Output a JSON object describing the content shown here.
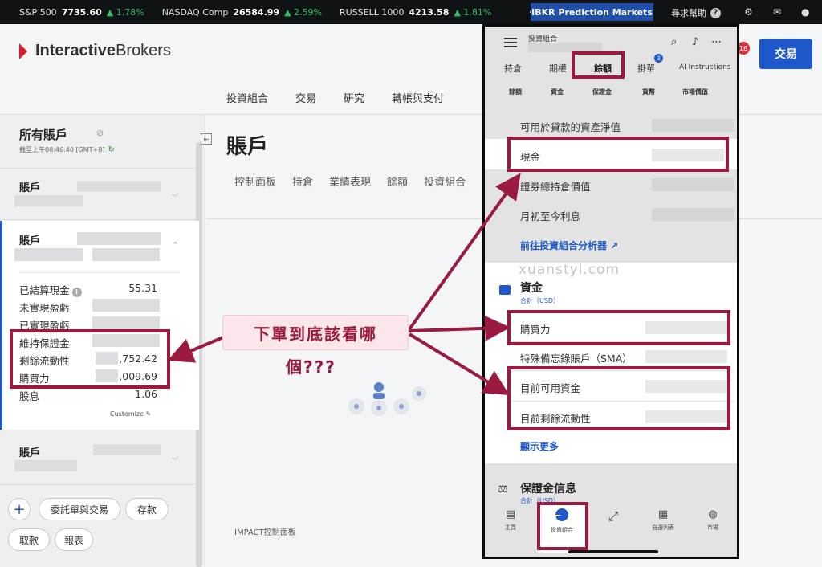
{
  "ticker": [
    {
      "name": "S&P 500",
      "value": "7735.60",
      "change": "▲ 1.78%"
    },
    {
      "name": "NASDAQ Comp",
      "value": "26584.99",
      "change": "▲ 2.59%"
    },
    {
      "name": "RUSSELL 1000",
      "value": "4213.58",
      "change": "▲ 1.81%"
    }
  ],
  "topbar": {
    "more": "•••",
    "prediction_markets": "IBKR Prediction Markets",
    "help": "尋求幫助",
    "help_q": "?"
  },
  "header": {
    "logo_bold": "Interactive",
    "logo_rest": "Brokers",
    "notif_count": "16",
    "trade_button": "交易"
  },
  "mainnav": [
    "投資組合",
    "交易",
    "研究",
    "轉帳與支付"
  ],
  "sidebar": {
    "title": "所有賬戶",
    "timestamp": "截至上午08:46:40 [GMT+8]",
    "account_label": "賬戶",
    "rows": [
      {
        "label": "已結算現金",
        "value": "55.31",
        "info": "i"
      },
      {
        "label": "未實現盈虧",
        "value": ""
      },
      {
        "label": "已實現盈虧",
        "value": ""
      },
      {
        "label": "維持保證金",
        "value": ""
      },
      {
        "label": "剩餘流動性",
        "value": ",752.42"
      },
      {
        "label": "購買力",
        "value": ",009.69"
      },
      {
        "label": "股息",
        "value": "1.06"
      }
    ],
    "customize": "Customize",
    "actions": {
      "plus": "+",
      "orders": "委託單與交易",
      "deposit": "存款",
      "withdraw": "取款",
      "reports": "報表"
    }
  },
  "main": {
    "title": "賬戶",
    "tabs": [
      "控制面板",
      "持倉",
      "業績表現",
      "餘額",
      "投資組合"
    ],
    "impact": "IMPACT控制面板"
  },
  "phone": {
    "title": "投資組合",
    "tabs": [
      "持倉",
      "期權",
      "餘額",
      "掛單",
      "AI Instructions"
    ],
    "orders_badge": "3",
    "subcols": [
      "餘額",
      "資金",
      "保證金",
      "貨幣",
      "市場價值"
    ],
    "balance_rows": [
      "可用於貸款的資產淨值",
      "現金",
      "證券總持倉價值",
      "月初至今利息"
    ],
    "portfolio_link": "前往投資組合分析器",
    "funds_title": "資金",
    "funds_sub": "合計（USD）",
    "funds_rows": [
      "購買力",
      "特殊備忘錄賬戶（SMA）",
      "目前可用資金",
      "目前剩餘流動性"
    ],
    "show_more": "顯示更多",
    "margin_title": "保證金信息",
    "margin_sub": "合計（USD）",
    "nav": [
      "主頁",
      "投資組合",
      "",
      "自選列表",
      "市場"
    ]
  },
  "annotation": {
    "line1": "下單到底該看哪",
    "line2": "個???",
    "watermark": "xuanstyl.com",
    "color": "#9a1b3f"
  }
}
